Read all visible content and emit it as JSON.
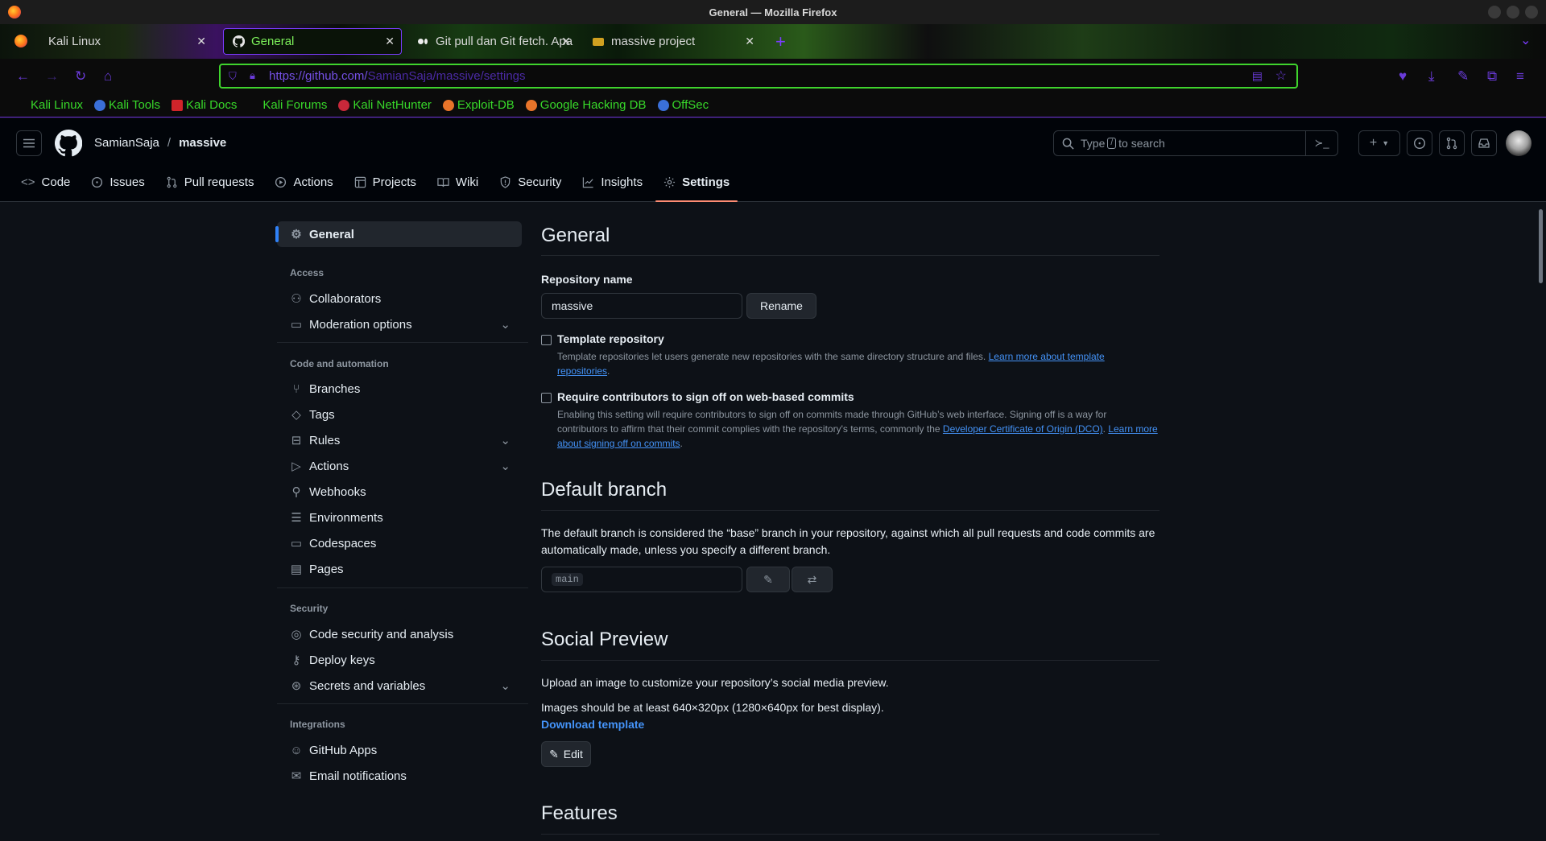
{
  "window": {
    "title": "General — Mozilla Firefox"
  },
  "tabs": [
    {
      "label": "Kali Linux",
      "active": false
    },
    {
      "label": "General",
      "active": true
    },
    {
      "label": "Git pull dan Git fetch. Apa",
      "active": false
    },
    {
      "label": "massive project",
      "active": false
    }
  ],
  "nav": {
    "url_host": "https://github.com/",
    "url_path": "SamianSaja/massive/settings"
  },
  "bookmarks": [
    {
      "label": "Kali Linux",
      "icon": "kali-dragon-icon"
    },
    {
      "label": "Kali Tools",
      "icon": "kali-tools-icon"
    },
    {
      "label": "Kali Docs",
      "icon": "kali-docs-icon"
    },
    {
      "label": "Kali Forums",
      "icon": "kali-forums-icon"
    },
    {
      "label": "Kali NetHunter",
      "icon": "nethunter-icon"
    },
    {
      "label": "Exploit-DB",
      "icon": "exploit-db-icon"
    },
    {
      "label": "Google Hacking DB",
      "icon": "ghdb-icon"
    },
    {
      "label": "OffSec",
      "icon": "offsec-icon"
    }
  ],
  "header": {
    "owner": "SamianSaja",
    "separator": "/",
    "repo": "massive",
    "search_pre": "Type",
    "search_key": "/",
    "search_post": "to search"
  },
  "repo_tabs": [
    {
      "label": "Code",
      "icon": "code-icon"
    },
    {
      "label": "Issues",
      "icon": "issue-icon"
    },
    {
      "label": "Pull requests",
      "icon": "pull-request-icon"
    },
    {
      "label": "Actions",
      "icon": "play-icon"
    },
    {
      "label": "Projects",
      "icon": "table-icon"
    },
    {
      "label": "Wiki",
      "icon": "book-icon"
    },
    {
      "label": "Security",
      "icon": "shield-icon"
    },
    {
      "label": "Insights",
      "icon": "graph-icon"
    },
    {
      "label": "Settings",
      "icon": "gear-icon",
      "selected": true
    }
  ],
  "sidebar": {
    "general": "General",
    "access_head": "Access",
    "collaborators": "Collaborators",
    "moderation": "Moderation options",
    "code_head": "Code and automation",
    "branches": "Branches",
    "tags": "Tags",
    "rules": "Rules",
    "actions": "Actions",
    "webhooks": "Webhooks",
    "environments": "Environments",
    "codespaces": "Codespaces",
    "pages": "Pages",
    "security_head": "Security",
    "code_security": "Code security and analysis",
    "deploy_keys": "Deploy keys",
    "secrets": "Secrets and variables",
    "integrations_head": "Integrations",
    "github_apps": "GitHub Apps",
    "email_notifications": "Email notifications"
  },
  "general": {
    "title": "General",
    "repo_name_label": "Repository name",
    "repo_name_value": "massive",
    "rename_button": "Rename",
    "template_label": "Template repository",
    "template_note": "Template repositories let users generate new repositories with the same directory structure and files.",
    "template_link_1": "Learn more about template",
    "template_link_2": "repositories",
    "signoff_label": "Require contributors to sign off on web-based commits",
    "signoff_note_1": "Enabling this setting will require contributors to sign off on commits made through GitHub’s web interface. Signing off is a way for",
    "signoff_note_2": "contributors to affirm that their commit complies with the repository's terms, commonly the",
    "signoff_dco_link": "Developer Certificate of Origin (DCO)",
    "signoff_learn_1": "Learn more",
    "signoff_learn_2": "about signing off on commits"
  },
  "default_branch": {
    "title": "Default branch",
    "desc_1": "The default branch is considered the “base” branch in your repository, against which all pull requests and code commits are",
    "desc_2": "automatically made, unless you specify a different branch.",
    "branch": "main"
  },
  "social_preview": {
    "title": "Social Preview",
    "desc": "Upload an image to customize your repository’s social media preview.",
    "size_note": "Images should be at least 640×320px (1280×640px for best display).",
    "download": "Download template",
    "edit": "Edit"
  },
  "features": {
    "title": "Features"
  }
}
